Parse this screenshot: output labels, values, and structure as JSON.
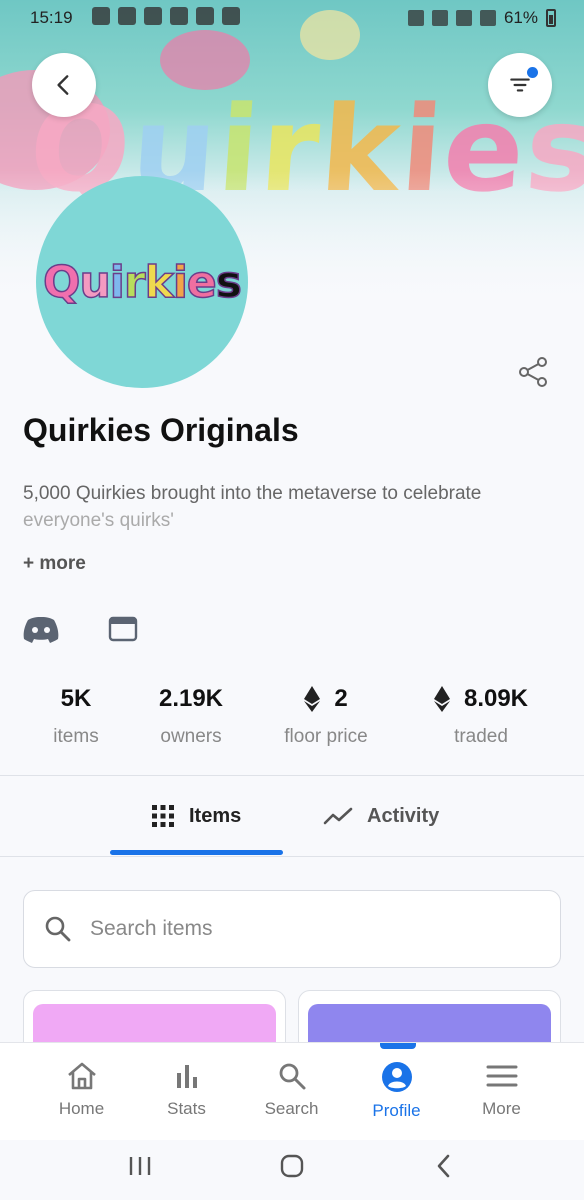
{
  "status_bar": {
    "time": "15:19",
    "battery": "61%"
  },
  "banner": {
    "word": [
      "Q",
      "u",
      "i",
      "r",
      "k",
      "i",
      "e",
      "s"
    ]
  },
  "avatar": {
    "logo_letters": [
      "Q",
      "u",
      "i",
      "r",
      "k",
      "i",
      "e",
      "s"
    ]
  },
  "collection": {
    "name": "Quirkies Originals",
    "description_line1": "5,000 Quirkies brought into the metaverse to celebrate",
    "description_line2": "everyone's quirks'",
    "more_label": "+ more"
  },
  "stats": [
    {
      "value": "5K",
      "label": "items",
      "eth": false
    },
    {
      "value": "2.19K",
      "label": "owners",
      "eth": false
    },
    {
      "value": "2",
      "label": "floor price",
      "eth": true
    },
    {
      "value": "8.09K",
      "label": "traded",
      "eth": true
    }
  ],
  "tabs": {
    "items": "Items",
    "activity": "Activity",
    "active": "items"
  },
  "search": {
    "placeholder": "Search items"
  },
  "cards": [
    {
      "color": "#f0a9f5"
    },
    {
      "color": "#8f86ee"
    }
  ],
  "bottom_nav": [
    {
      "label": "Home",
      "icon": "home-icon"
    },
    {
      "label": "Stats",
      "icon": "stats-icon"
    },
    {
      "label": "Search",
      "icon": "search-icon"
    },
    {
      "label": "Profile",
      "icon": "profile-icon",
      "active": true
    },
    {
      "label": "More",
      "icon": "menu-icon"
    }
  ],
  "colors": {
    "accent": "#1a73e8",
    "avatar_bg": "#7fd7d6"
  }
}
